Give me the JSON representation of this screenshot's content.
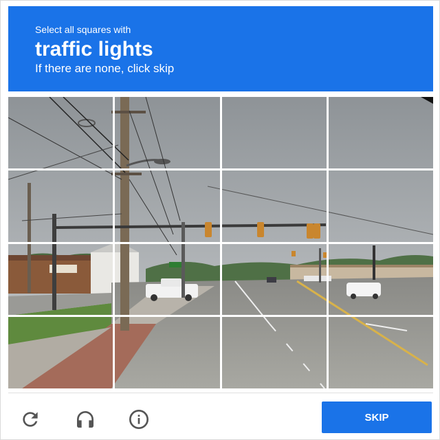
{
  "captcha": {
    "instruction_small": "Select all squares with",
    "target_object": "traffic lights",
    "instruction_sub": "If there are none, click skip",
    "grid_rows": 4,
    "grid_cols": 4
  },
  "footer": {
    "reload_icon": "reload-icon",
    "audio_icon": "headphones-icon",
    "info_icon": "info-icon",
    "skip_label": "SKIP"
  },
  "colors": {
    "accent": "#1a73e8"
  }
}
